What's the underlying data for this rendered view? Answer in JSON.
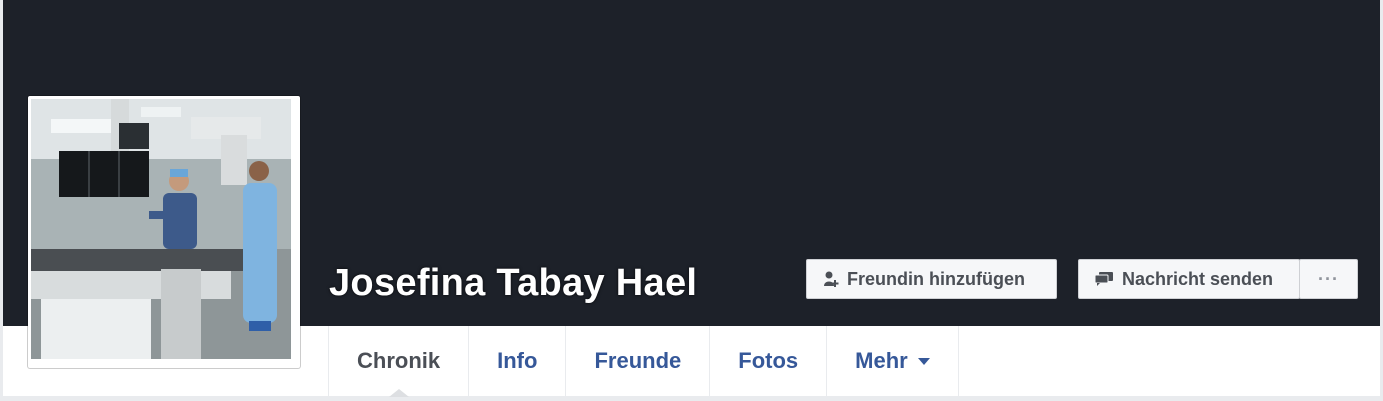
{
  "profile": {
    "name": "Josefina Tabay Hael",
    "picture_icon": "profile-photo"
  },
  "actions": {
    "add_friend_label": "Freundin hinzufügen",
    "add_friend_icon": "add-friend-icon",
    "message_label": "Nachricht senden",
    "message_icon": "message-icon",
    "more_label": "···"
  },
  "tabs": [
    {
      "label": "Chronik",
      "active": true
    },
    {
      "label": "Info",
      "active": false
    },
    {
      "label": "Freunde",
      "active": false
    },
    {
      "label": "Fotos",
      "active": false
    },
    {
      "label": "Mehr",
      "active": false
    }
  ],
  "colors": {
    "cover": "#1d2129",
    "link": "#365899",
    "active_tab": "#4b4f56",
    "button_bg": "#f6f7f9"
  }
}
